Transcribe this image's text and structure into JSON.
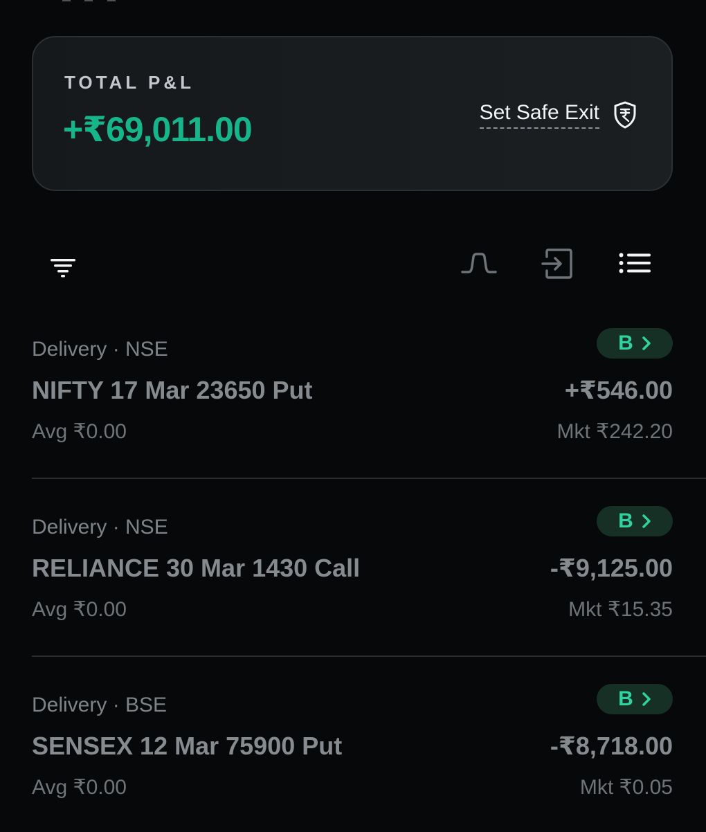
{
  "summary": {
    "label": "TOTAL P&L",
    "value": "+₹69,011.00",
    "safe_exit_label": "Set Safe Exit",
    "accent_color": "#17b58a"
  },
  "toolbar": {
    "icons": [
      "filter-icon",
      "payoff-graph-icon",
      "exit-icon",
      "list-view-icon"
    ]
  },
  "positions": [
    {
      "meta": "Delivery · NSE",
      "name": "NIFTY 17 Mar 23650 Put",
      "avg": "Avg ₹0.00",
      "badge": "B",
      "pnl": "+₹546.00",
      "mkt": "Mkt ₹242.20"
    },
    {
      "meta": "Delivery · NSE",
      "name": "RELIANCE 30 Mar 1430 Call",
      "avg": "Avg ₹0.00",
      "badge": "B",
      "pnl": "-₹9,125.00",
      "mkt": "Mkt ₹15.35"
    },
    {
      "meta": "Delivery · BSE",
      "name": "SENSEX 12 Mar 75900 Put",
      "avg": "Avg ₹0.00",
      "badge": "B",
      "pnl": "-₹8,718.00",
      "mkt": "Mkt ₹0.05"
    }
  ]
}
